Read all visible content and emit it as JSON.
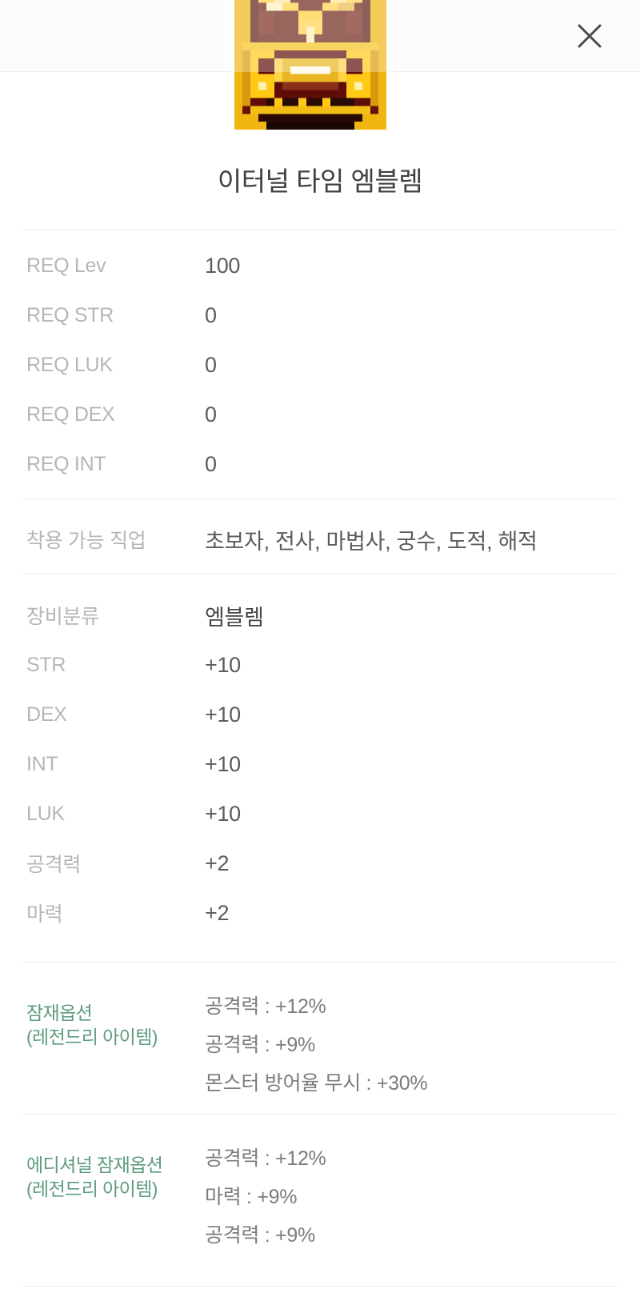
{
  "header": {
    "close_icon": "close-icon"
  },
  "item": {
    "icon_name": "eternal-time-emblem-icon",
    "name": "이터널 타임 엠블렘"
  },
  "requirements": [
    {
      "label": "REQ Lev",
      "value": "100"
    },
    {
      "label": "REQ STR",
      "value": "0"
    },
    {
      "label": "REQ LUK",
      "value": "0"
    },
    {
      "label": "REQ DEX",
      "value": "0"
    },
    {
      "label": "REQ INT",
      "value": "0"
    }
  ],
  "job": {
    "label": "착용 가능 직업",
    "value": "초보자, 전사, 마법사, 궁수, 도적, 해적"
  },
  "equipment": [
    {
      "label": "장비분류",
      "value": "엠블렘"
    },
    {
      "label": "STR",
      "value": "+10"
    },
    {
      "label": "DEX",
      "value": "+10"
    },
    {
      "label": "INT",
      "value": "+10"
    },
    {
      "label": "LUK",
      "value": "+10"
    },
    {
      "label": "공격력",
      "value": "+2"
    },
    {
      "label": "마력",
      "value": "+2"
    }
  ],
  "potential": {
    "label": "잠재옵션",
    "grade": "(레전드리 아이템)",
    "lines": [
      "공격력 : +12%",
      "공격력 : +9%",
      "몬스터 방어율 무시 : +30%"
    ]
  },
  "additional_potential": {
    "label": "에디셔널 잠재옵션",
    "grade": "(레전드리 아이템)",
    "lines": [
      "공격력 : +12%",
      "마력 : +9%",
      "공격력 : +9%"
    ]
  },
  "colors": {
    "potential_green": "#5d9b7e",
    "label_gray": "#b6b6ba",
    "value_gray": "#5b5b60",
    "divider": "#eaeaea"
  }
}
